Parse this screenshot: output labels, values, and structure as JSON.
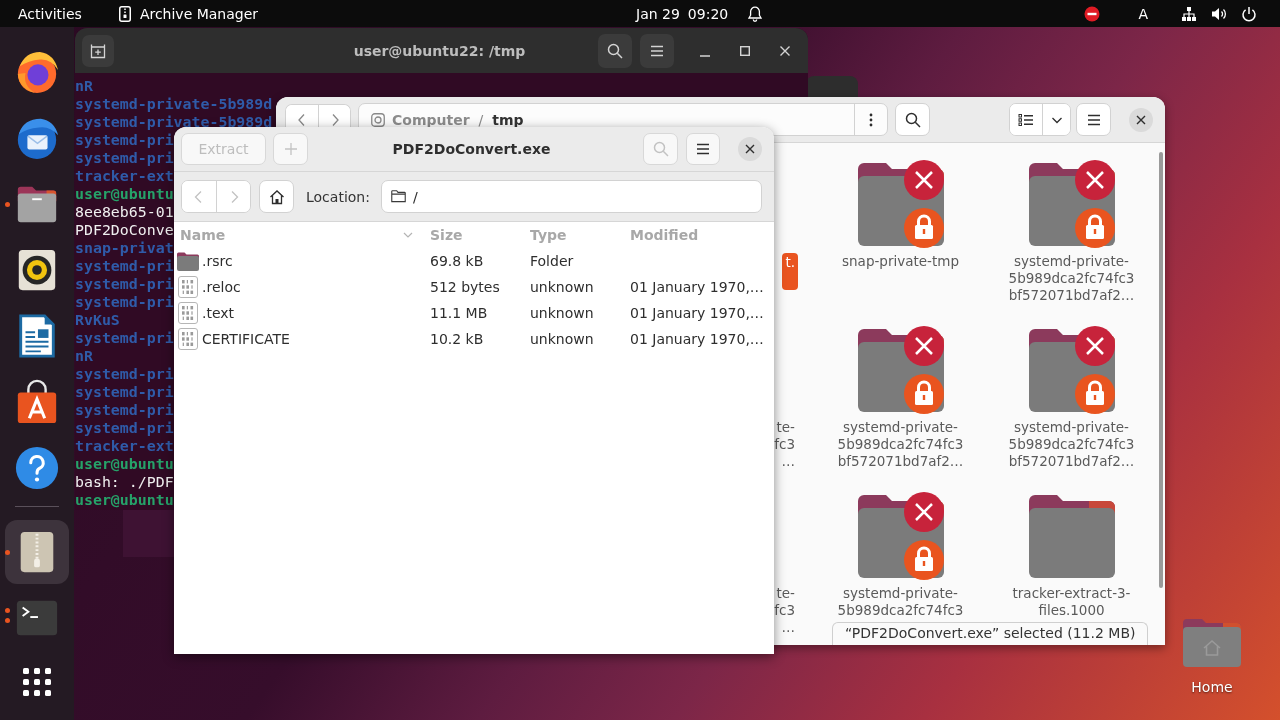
{
  "top_bar": {
    "activities": "Activities",
    "app_name": "Archive Manager",
    "date": "Jan 29",
    "time": "09:20",
    "input_source": "A"
  },
  "dock": {
    "pinned": [
      {
        "kind": "browser",
        "running": false,
        "multiple_windows": false,
        "selected": false
      },
      {
        "kind": "mail",
        "running": false,
        "multiple_windows": false,
        "selected": false
      },
      {
        "kind": "files",
        "running": true,
        "multiple_windows": false,
        "selected": false
      },
      {
        "kind": "music",
        "running": false,
        "multiple_windows": false,
        "selected": false
      },
      {
        "kind": "writer",
        "running": false,
        "multiple_windows": false,
        "selected": false
      },
      {
        "kind": "store",
        "running": false,
        "multiple_windows": false,
        "selected": false
      },
      {
        "kind": "help",
        "running": false,
        "multiple_windows": false,
        "selected": false
      }
    ],
    "unpinned": [
      {
        "kind": "archive",
        "running": true,
        "multiple_windows": false,
        "selected": true
      },
      {
        "kind": "terminal",
        "running": true,
        "multiple_windows": true,
        "selected": false
      }
    ]
  },
  "terminal": {
    "title": "user@ubuntu22: /tmp",
    "lines": [
      {
        "text": "nR",
        "kind": "dir"
      },
      {
        "text": "systemd-private-5b989d",
        "kind": "dir"
      },
      {
        "text": "systemd-private-5b989d",
        "kind": "dir"
      },
      {
        "text": "systemd-pri",
        "kind": "dir"
      },
      {
        "text": "systemd-pri",
        "kind": "dir"
      },
      {
        "text": "tracker-ext",
        "kind": "dir"
      },
      {
        "text": "user@ubuntu",
        "kind": "prompt"
      },
      {
        "text": "8ee8eb65-01",
        "kind": "plain"
      },
      {
        "text": "PDF2DoConve",
        "kind": "plain"
      },
      {
        "text": "snap-privat",
        "kind": "dir"
      },
      {
        "text": "systemd-pri",
        "kind": "dir"
      },
      {
        "text": "systemd-pri",
        "kind": "dir"
      },
      {
        "text": "systemd-pri",
        "kind": "dir"
      },
      {
        "text": "RvKuS",
        "kind": "dir"
      },
      {
        "text": "systemd-pri",
        "kind": "dir"
      },
      {
        "text": "nR",
        "kind": "dir"
      },
      {
        "text": "systemd-pri",
        "kind": "dir"
      },
      {
        "text": "systemd-pri",
        "kind": "dir"
      },
      {
        "text": "systemd-pri",
        "kind": "dir"
      },
      {
        "text": "systemd-pri",
        "kind": "dir"
      },
      {
        "text": "tracker-ext",
        "kind": "dir"
      },
      {
        "text": "user@ubuntu",
        "kind": "prompt"
      },
      {
        "text": "bash: ./PDF",
        "kind": "plain"
      },
      {
        "text": "user@ubuntu",
        "kind": "prompt"
      }
    ]
  },
  "file_manager": {
    "path": {
      "segments": [
        {
          "label": "Computer",
          "current": false
        },
        {
          "label": "tmp",
          "current": true
        }
      ],
      "separator": "/"
    },
    "items": [
      {
        "kind": "covered",
        "label": [
          "t."
        ],
        "selected": true
      },
      {
        "kind": "folder",
        "label": [
          "snap-private-tmp"
        ],
        "locked": true,
        "selected": false
      },
      {
        "kind": "folder",
        "label": [
          "systemd-private-",
          "5b989dca2fc74fc3",
          "bf572071bd7af2…"
        ],
        "locked": true,
        "selected": false
      },
      {
        "kind": "covered",
        "label": [
          "te-",
          "fc3",
          "…"
        ],
        "selected": false
      },
      {
        "kind": "folder",
        "label": [
          "systemd-private-",
          "5b989dca2fc74fc3",
          "bf572071bd7af2…"
        ],
        "locked": true,
        "selected": false
      },
      {
        "kind": "folder",
        "label": [
          "systemd-private-",
          "5b989dca2fc74fc3",
          "bf572071bd7af2…"
        ],
        "locked": true,
        "selected": false
      },
      {
        "kind": "covered",
        "label": [
          "te-",
          "fc3",
          "…"
        ],
        "selected": false
      },
      {
        "kind": "folder",
        "label": [
          "systemd-private-",
          "5b989dca2fc74fc3"
        ],
        "locked": true,
        "selected": false
      },
      {
        "kind": "folder",
        "label": [
          "tracker-extract-3-",
          "files.1000"
        ],
        "locked": false,
        "selected": false
      }
    ],
    "status": "“PDF2DoConvert.exe” selected (11.2 MB)"
  },
  "archive_manager": {
    "title": "PDF2DoConvert.exe",
    "extract": {
      "label": "Extract",
      "disabled": true
    },
    "add": {
      "disabled": true
    },
    "search": {
      "disabled": true
    },
    "back": {
      "disabled": true
    },
    "forward": {
      "disabled": true
    },
    "location": {
      "label": "Location:",
      "value": "/"
    },
    "columns": [
      {
        "label": "Name",
        "sorted": true
      },
      {
        "label": "Size",
        "sorted": false
      },
      {
        "label": "Type",
        "sorted": false
      },
      {
        "label": "Modified",
        "sorted": false
      }
    ],
    "rows": [
      {
        "kind": "folder",
        "name": ".rsrc",
        "size": "69.8 kB",
        "type": "Folder",
        "selected": false
      },
      {
        "kind": "binary",
        "name": ".reloc",
        "size": "512 bytes",
        "type": "unknown",
        "modified": "01 January 1970,…",
        "selected": false
      },
      {
        "kind": "binary",
        "name": ".text",
        "size": "11.1 MB",
        "type": "unknown",
        "modified": "01 January 1970,…",
        "selected": false
      },
      {
        "kind": "binary",
        "name": "CERTIFICATE",
        "size": "10.2 kB",
        "type": "unknown",
        "modified": "01 January 1970,…",
        "selected": false
      }
    ]
  },
  "desktop": {
    "icons": [
      {
        "label": "Home"
      }
    ]
  }
}
